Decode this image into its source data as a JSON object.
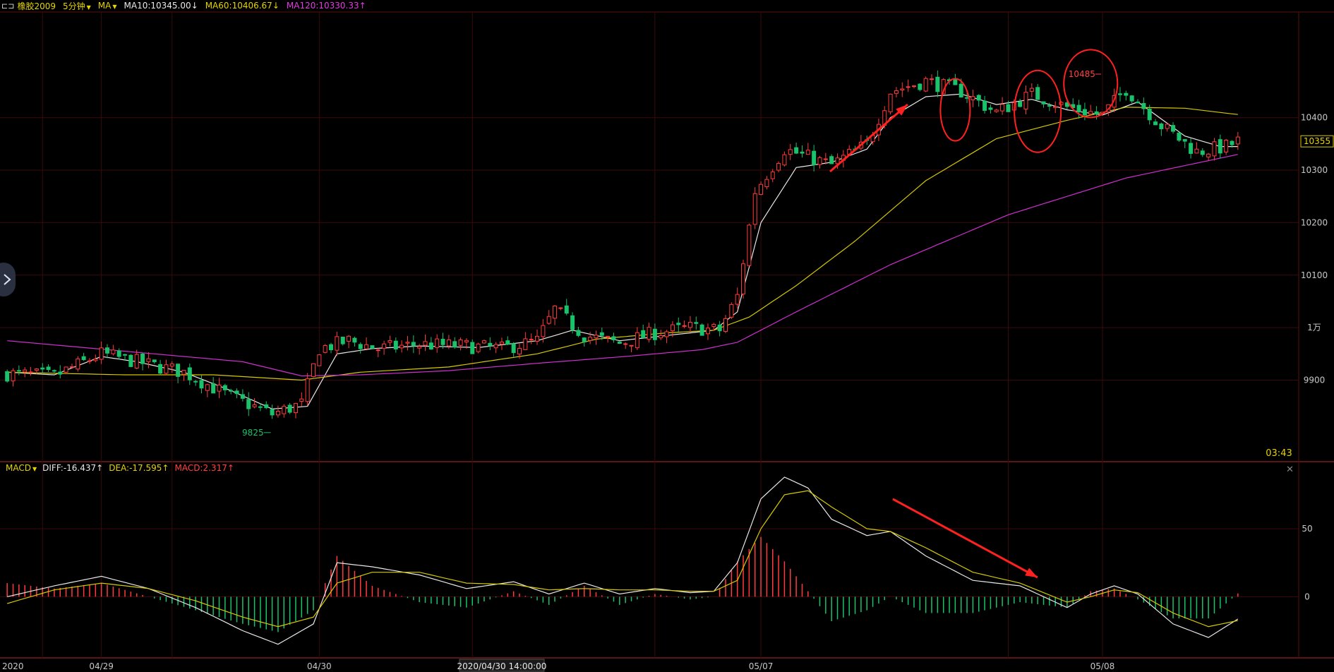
{
  "header": {
    "app_icon": "window-switch-icon",
    "symbol": "橡胶2009",
    "period": "5分钟",
    "indicator": "MA",
    "ma10": "MA10:10345.00↓",
    "ma60": "MA60:10406.67↓",
    "ma120": "MA120:10330.33↑"
  },
  "macd_header": {
    "name": "MACD",
    "diff": "DIFF:-16.437↑",
    "dea": "DEA:-17.595↑",
    "macd": "MACD:2.317↑"
  },
  "colors": {
    "up": "#ff3b3b",
    "down": "#19c26b",
    "ma10": "#e8e8e8",
    "ma60": "#d6c800",
    "ma120": "#d02fd0",
    "grid": "#3a0a0a",
    "axis_text": "#c8c8c8",
    "annotation": "#ff2020"
  },
  "time_label": "03:43",
  "current_price": "10355",
  "high_label": "10485",
  "low_label": "9825",
  "crosshair_time": "2020/04/30 14:00:00",
  "chart_data": [
    {
      "type": "candlestick",
      "title": "橡胶2009",
      "ylim": [
        9750,
        10600
      ],
      "y_ticks": [
        {
          "value": 10400,
          "label": "10400"
        },
        {
          "value": 10300,
          "label": "10300"
        },
        {
          "value": 10200,
          "label": "10200"
        },
        {
          "value": 10100,
          "label": "10100"
        },
        {
          "value": 10000,
          "label": "1万"
        },
        {
          "value": 9900,
          "label": "9900"
        }
      ],
      "x_ticks": [
        {
          "x": 0,
          "label": "2020"
        },
        {
          "x": 16,
          "label": "04/29"
        },
        {
          "x": 53,
          "label": "04/30"
        },
        {
          "x": 128,
          "label": "05/07"
        },
        {
          "x": 186,
          "label": "05/08"
        }
      ],
      "n": 210,
      "price_anchors": [
        [
          0,
          9912
        ],
        [
          8,
          9908
        ],
        [
          16,
          9950
        ],
        [
          22,
          9935
        ],
        [
          30,
          9915
        ],
        [
          38,
          9868
        ],
        [
          45,
          9835
        ],
        [
          50,
          9855
        ],
        [
          53,
          9960
        ],
        [
          58,
          9975
        ],
        [
          63,
          9960
        ],
        [
          70,
          9968
        ],
        [
          78,
          9965
        ],
        [
          84,
          9960
        ],
        [
          90,
          9975
        ],
        [
          93,
          10035
        ],
        [
          98,
          9985
        ],
        [
          104,
          9970
        ],
        [
          110,
          9990
        ],
        [
          116,
          10000
        ],
        [
          121,
          9995
        ],
        [
          124,
          10060
        ],
        [
          127,
          10260
        ],
        [
          132,
          10340
        ],
        [
          140,
          10310
        ],
        [
          146,
          10350
        ],
        [
          150,
          10450
        ],
        [
          156,
          10470
        ],
        [
          162,
          10450
        ],
        [
          168,
          10410
        ],
        [
          174,
          10445
        ],
        [
          180,
          10420
        ],
        [
          186,
          10405
        ],
        [
          190,
          10455
        ],
        [
          196,
          10385
        ],
        [
          202,
          10335
        ],
        [
          207,
          10345
        ],
        [
          209,
          10355
        ]
      ],
      "series": [
        {
          "name": "MA10",
          "anchors": [
            [
              0,
              9915
            ],
            [
              8,
              9910
            ],
            [
              16,
              9945
            ],
            [
              22,
              9935
            ],
            [
              30,
              9915
            ],
            [
              38,
              9880
            ],
            [
              45,
              9845
            ],
            [
              51,
              9850
            ],
            [
              56,
              9950
            ],
            [
              62,
              9960
            ],
            [
              70,
              9965
            ],
            [
              80,
              9962
            ],
            [
              90,
              9975
            ],
            [
              96,
              9995
            ],
            [
              104,
              9975
            ],
            [
              112,
              9985
            ],
            [
              120,
              9995
            ],
            [
              124,
              10030
            ],
            [
              128,
              10200
            ],
            [
              134,
              10305
            ],
            [
              140,
              10315
            ],
            [
              146,
              10340
            ],
            [
              150,
              10400
            ],
            [
              156,
              10440
            ],
            [
              162,
              10445
            ],
            [
              168,
              10425
            ],
            [
              174,
              10435
            ],
            [
              180,
              10415
            ],
            [
              186,
              10405
            ],
            [
              192,
              10430
            ],
            [
              200,
              10365
            ],
            [
              206,
              10345
            ],
            [
              209,
              10345
            ]
          ]
        },
        {
          "name": "MA60",
          "anchors": [
            [
              0,
              9915
            ],
            [
              20,
              9910
            ],
            [
              35,
              9910
            ],
            [
              50,
              9900
            ],
            [
              60,
              9915
            ],
            [
              75,
              9925
            ],
            [
              90,
              9950
            ],
            [
              100,
              9978
            ],
            [
              112,
              9990
            ],
            [
              120,
              9995
            ],
            [
              126,
              10020
            ],
            [
              134,
              10080
            ],
            [
              144,
              10165
            ],
            [
              156,
              10280
            ],
            [
              168,
              10360
            ],
            [
              180,
              10395
            ],
            [
              190,
              10420
            ],
            [
              200,
              10418
            ],
            [
              209,
              10406
            ]
          ]
        },
        {
          "name": "MA120",
          "anchors": [
            [
              0,
              9975
            ],
            [
              20,
              9955
            ],
            [
              40,
              9935
            ],
            [
              50,
              9908
            ],
            [
              60,
              9910
            ],
            [
              75,
              9918
            ],
            [
              90,
              9932
            ],
            [
              105,
              9945
            ],
            [
              118,
              9958
            ],
            [
              124,
              9972
            ],
            [
              134,
              10030
            ],
            [
              150,
              10120
            ],
            [
              170,
              10215
            ],
            [
              190,
              10285
            ],
            [
              209,
              10330
            ]
          ]
        }
      ]
    },
    {
      "type": "line+bar",
      "title": "MACD",
      "ylim": [
        -45,
        90
      ],
      "y_ticks": [
        {
          "value": 50,
          "label": "50"
        },
        {
          "value": 0,
          "label": "0"
        }
      ],
      "series": [
        {
          "name": "DIFF",
          "anchors": [
            [
              0,
              0
            ],
            [
              8,
              8
            ],
            [
              16,
              15
            ],
            [
              24,
              6
            ],
            [
              32,
              -8
            ],
            [
              40,
              -25
            ],
            [
              46,
              -35
            ],
            [
              52,
              -20
            ],
            [
              56,
              25
            ],
            [
              62,
              22
            ],
            [
              70,
              16
            ],
            [
              78,
              6
            ],
            [
              86,
              11
            ],
            [
              92,
              2
            ],
            [
              98,
              10
            ],
            [
              104,
              2
            ],
            [
              110,
              6
            ],
            [
              116,
              3
            ],
            [
              120,
              4
            ],
            [
              124,
              25
            ],
            [
              128,
              72
            ],
            [
              132,
              88
            ],
            [
              136,
              80
            ],
            [
              140,
              57
            ],
            [
              146,
              45
            ],
            [
              150,
              48
            ],
            [
              156,
              30
            ],
            [
              164,
              12
            ],
            [
              172,
              8
            ],
            [
              180,
              -8
            ],
            [
              184,
              2
            ],
            [
              188,
              8
            ],
            [
              192,
              2
            ],
            [
              198,
              -20
            ],
            [
              204,
              -30
            ],
            [
              209,
              -16.4
            ]
          ]
        },
        {
          "name": "DEA",
          "anchors": [
            [
              0,
              -5
            ],
            [
              8,
              5
            ],
            [
              16,
              10
            ],
            [
              24,
              6
            ],
            [
              32,
              -3
            ],
            [
              40,
              -15
            ],
            [
              46,
              -22
            ],
            [
              52,
              -15
            ],
            [
              56,
              10
            ],
            [
              62,
              18
            ],
            [
              70,
              18
            ],
            [
              78,
              10
            ],
            [
              86,
              9
            ],
            [
              92,
              5
            ],
            [
              98,
              6
            ],
            [
              104,
              5
            ],
            [
              110,
              5
            ],
            [
              116,
              4
            ],
            [
              120,
              4
            ],
            [
              124,
              12
            ],
            [
              128,
              50
            ],
            [
              132,
              75
            ],
            [
              136,
              78
            ],
            [
              140,
              66
            ],
            [
              146,
              50
            ],
            [
              150,
              48
            ],
            [
              156,
              36
            ],
            [
              164,
              18
            ],
            [
              172,
              10
            ],
            [
              180,
              -4
            ],
            [
              184,
              0
            ],
            [
              188,
              5
            ],
            [
              192,
              3
            ],
            [
              198,
              -12
            ],
            [
              204,
              -22
            ],
            [
              209,
              -17.6
            ]
          ]
        }
      ],
      "histogram": "2 × (DIFF − DEA)"
    }
  ]
}
